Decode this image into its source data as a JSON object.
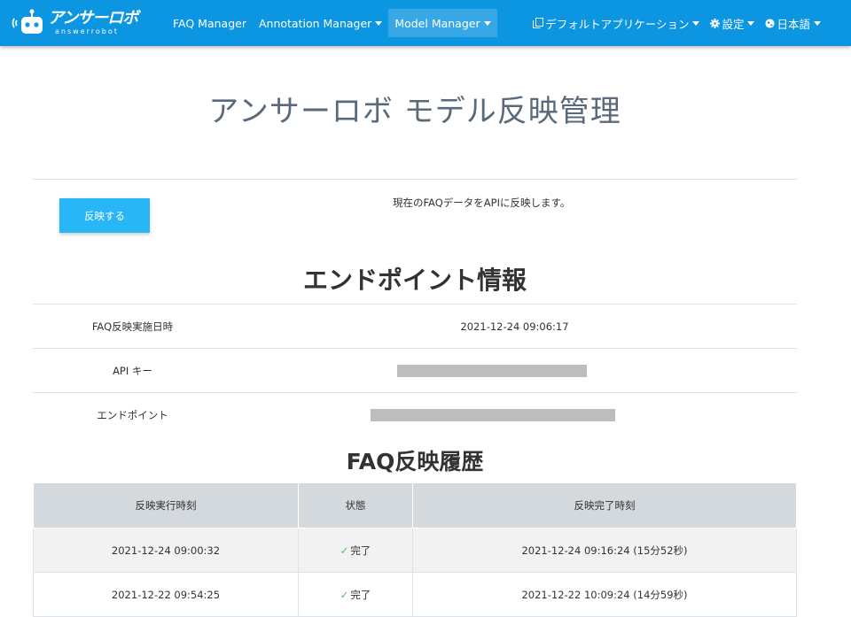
{
  "brand": {
    "name": "アンサーロボ",
    "sub": "answerrobot"
  },
  "nav": {
    "faq_manager": "FAQ Manager",
    "annotation_manager": "Annotation Manager",
    "model_manager": "Model Manager",
    "default_app": "デフォルトアプリケーション",
    "settings": "設定",
    "language": "日本語"
  },
  "page": {
    "title": "アンサーロボ モデル反映管理",
    "reflect_button": "反映する",
    "reflect_description": "現在のFAQデータをAPIに反映します。"
  },
  "endpoint": {
    "title": "エンドポイント情報",
    "rows": [
      {
        "label": "FAQ反映実施日時",
        "value": "2021-12-24 09:06:17"
      },
      {
        "label": "API キー",
        "value": ""
      },
      {
        "label": "エンドポイント",
        "value": ""
      }
    ]
  },
  "history": {
    "title": "FAQ反映履歴",
    "headers": [
      "反映実行時刻",
      "状態",
      "反映完了時刻"
    ],
    "rows": [
      {
        "start": "2021-12-24 09:00:32",
        "status": "完了",
        "end": "2021-12-24 09:16:24 (15分52秒)"
      },
      {
        "start": "2021-12-22 09:54:25",
        "status": "完了",
        "end": "2021-12-22 10:09:24 (14分59秒)"
      }
    ]
  },
  "colors": {
    "navbar": "#0c95e0",
    "button": "#29b6f6",
    "check": "#5cb85c"
  }
}
